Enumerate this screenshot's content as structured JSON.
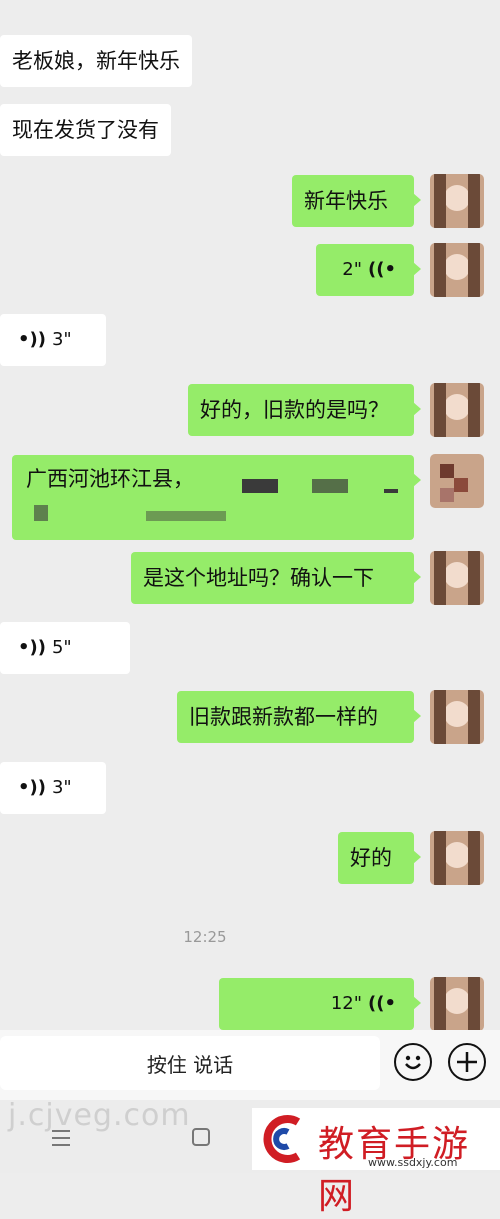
{
  "messages": [
    {
      "side": "left",
      "type": "text",
      "text": "老板娘，新年快乐"
    },
    {
      "side": "left",
      "type": "text",
      "text": "现在发货了没有"
    },
    {
      "side": "right",
      "type": "text",
      "text": "新年快乐"
    },
    {
      "side": "right",
      "type": "voice",
      "duration": "2\""
    },
    {
      "side": "left",
      "type": "voice",
      "duration": "3\""
    },
    {
      "side": "right",
      "type": "text",
      "text": "好的，旧款的是吗？"
    },
    {
      "side": "right",
      "type": "text",
      "text": "广西河池环江县，"
    },
    {
      "side": "right",
      "type": "text",
      "text": "是这个地址吗？确认一下"
    },
    {
      "side": "left",
      "type": "voice",
      "duration": "5\""
    },
    {
      "side": "right",
      "type": "text",
      "text": "旧款跟新款都一样的"
    },
    {
      "side": "left",
      "type": "voice",
      "duration": "3\""
    },
    {
      "side": "right",
      "type": "text",
      "text": "好的"
    },
    {
      "side": "right",
      "type": "voice",
      "duration": "12\""
    }
  ],
  "timestamp": "12:25",
  "input": {
    "hold_to_talk": "按住 说话"
  },
  "watermark": "j.cjveg.com",
  "logo": {
    "name": "教育手游网",
    "url": "www.ssdxjy.com"
  },
  "colors": {
    "bubble_right": "#95ec69",
    "bubble_left": "#ffffff",
    "background": "#ededed"
  }
}
